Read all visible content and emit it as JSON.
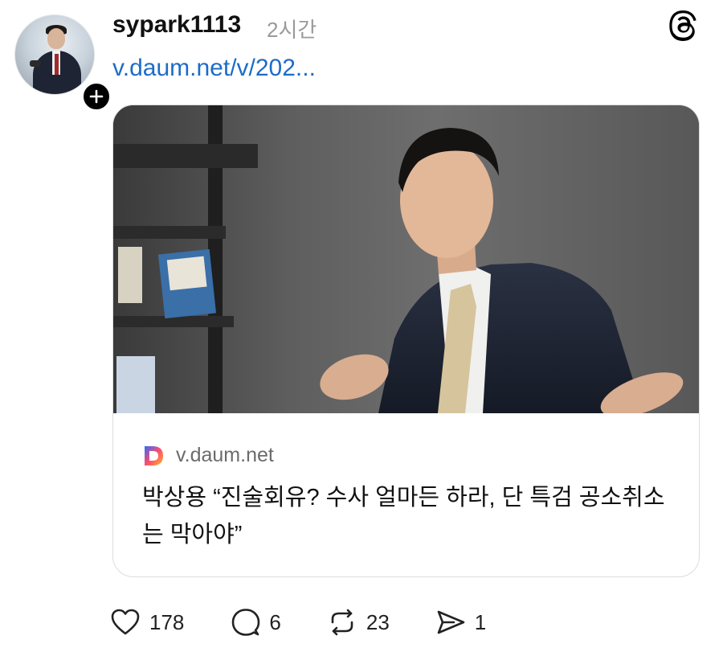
{
  "post": {
    "username": "sypark1113",
    "time": "2시간",
    "link": "v.daum.net/v/202..."
  },
  "link_card": {
    "source": "v.daum.net",
    "headline": "박상용 “진술회유? 수사 얼마든 하라, 단 특검 공소취소는 막아야”"
  },
  "actions": {
    "likes": "178",
    "replies": "6",
    "reposts": "23",
    "shares": "1"
  },
  "icons": {
    "avatar_badge": "plus-icon",
    "app": "threads-logo-icon",
    "like": "heart-icon",
    "reply": "comment-icon",
    "repost": "repost-icon",
    "share": "send-icon"
  },
  "colors": {
    "link": "#1d6cc8",
    "muted": "#9a9a9a"
  }
}
